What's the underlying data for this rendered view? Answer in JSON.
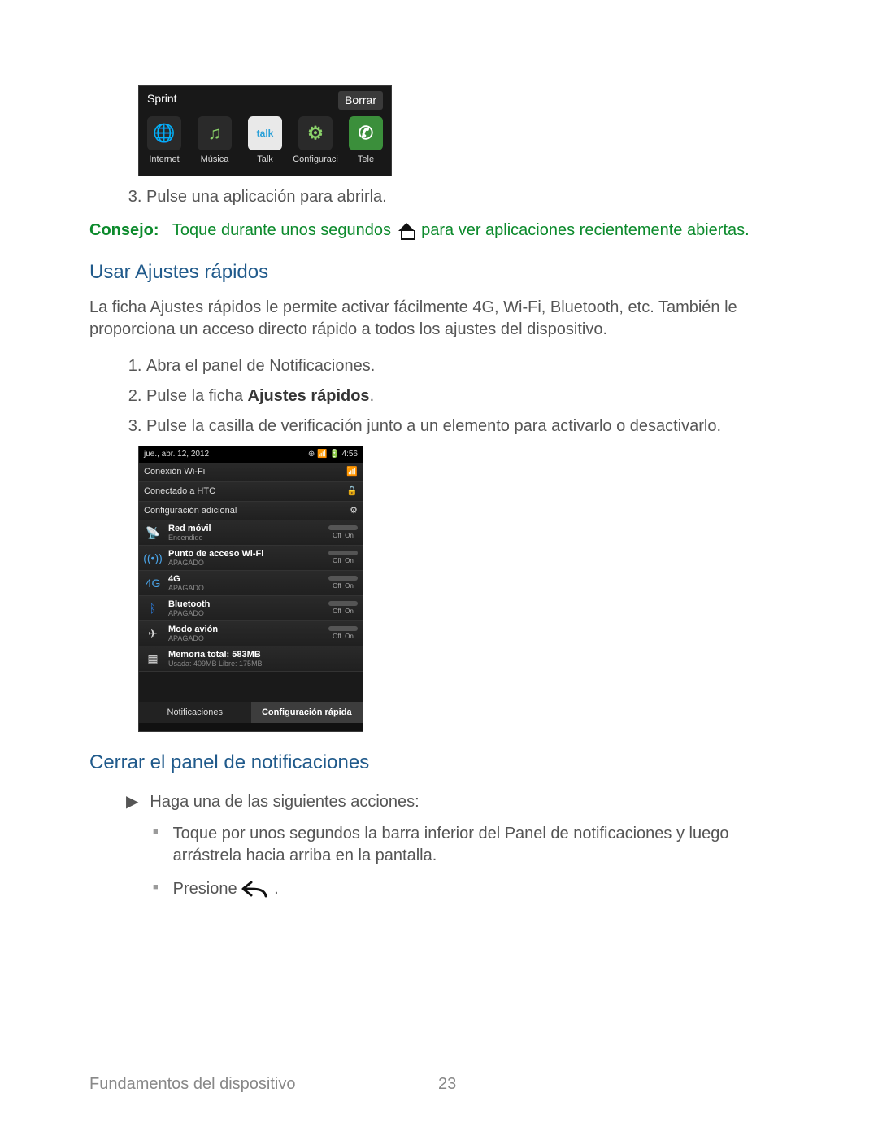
{
  "screenshot1": {
    "carrier": "Sprint",
    "clear": "Borrar",
    "apps": [
      {
        "name": "internet",
        "label": "Internet",
        "icon": "🌐",
        "bg": "#2a2a2a",
        "fg": "#8bd36a"
      },
      {
        "name": "musica",
        "label": "Música",
        "icon": "♫",
        "bg": "#2a2a2a",
        "fg": "#8bd36a"
      },
      {
        "name": "talk",
        "label": "Talk",
        "icon": "talk",
        "bg": "#e9e9e9",
        "fg": "#2aa0d8"
      },
      {
        "name": "config",
        "label": "Configuraci",
        "icon": "⚙",
        "bg": "#2a2a2a",
        "fg": "#8bd36a"
      },
      {
        "name": "tel",
        "label": "Tele",
        "icon": "✆",
        "bg": "#3b8f3b",
        "fg": "#fff"
      }
    ]
  },
  "step3_before_tip": "Pulse una aplicación para abrirla.",
  "tip": {
    "label": "Consejo:",
    "before": "Toque durante unos segundos",
    "after": "para ver aplicaciones recientemente abiertas."
  },
  "heading_quick": "Usar Ajustes rápidos",
  "quick_intro": "La ficha Ajustes rápidos le permite activar fácilmente 4G, Wi-Fi, Bluetooth, etc. También le proporciona un acceso directo rápido a todos los ajustes del dispositivo.",
  "quick_steps": {
    "s1": "Abra el panel de Notificaciones.",
    "s2a": "Pulse la ficha ",
    "s2b": "Ajustes rápidos",
    "s2c": ".",
    "s3": "Pulse la casilla de verificación junto a un elemento para activarlo o desactivarlo."
  },
  "screenshot2": {
    "status_left": "jue., abr. 12, 2012",
    "status_right": "4:56",
    "row_wifi_title": "Conexión Wi-Fi",
    "row_wifi_conn": "Conectado a HTC",
    "row_config": "Configuración adicional",
    "rows": [
      {
        "name": "red-movil",
        "title": "Red móvil",
        "sub": "Encendido",
        "icon": "📡",
        "color": "#4aa4e8"
      },
      {
        "name": "hotspot",
        "title": "Punto de acceso Wi-Fi",
        "sub": "APAGADO",
        "icon": "((•))",
        "color": "#4aa4e8"
      },
      {
        "name": "4g",
        "title": "4G",
        "sub": "APAGADO",
        "icon": "4G",
        "color": "#4aa4e8"
      },
      {
        "name": "bt",
        "title": "Bluetooth",
        "sub": "APAGADO",
        "icon": "ᛒ",
        "color": "#2d7fe0"
      },
      {
        "name": "avion",
        "title": "Modo avión",
        "sub": "APAGADO",
        "icon": "✈",
        "color": "#ddd"
      }
    ],
    "mem_title": "Memoria total: 583MB",
    "mem_sub": "Usada: 409MB   Libre: 175MB",
    "tab_notif": "Notificaciones",
    "tab_quick": "Configuración rápida",
    "off": "Off",
    "on": "On"
  },
  "heading_close": "Cerrar el panel de notificaciones",
  "close_intro": "Haga una de las siguientes acciones:",
  "close_b1": "Toque por unos segundos la barra inferior del Panel de notificaciones y luego arrástrela hacia arriba en la pantalla.",
  "close_b2": "Presione ",
  "close_b2_after": ".",
  "footer": {
    "section": "Fundamentos del dispositivo",
    "page": "23"
  }
}
